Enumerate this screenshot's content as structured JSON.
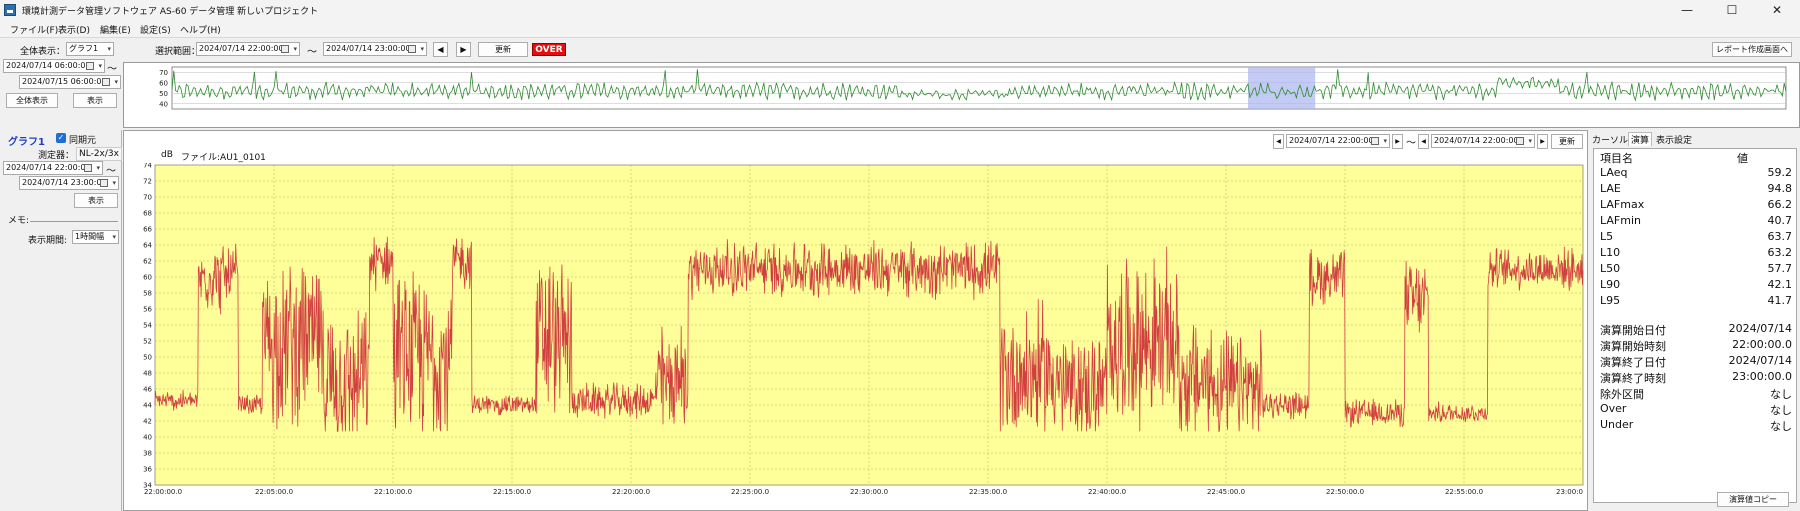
{
  "window": {
    "title": "環境計測データ管理ソフトウェア AS-60 データ管理 新しいプロジェクト",
    "minimize": "—",
    "maximize": "☐",
    "close": "✕"
  },
  "menu": [
    "ファイル(F)",
    "表示(D)",
    "編集(E)",
    "設定(S)",
    "ヘルプ(H)"
  ],
  "toolbar": {
    "all_display_label": "全体表示：",
    "graph_select": "グラフ1",
    "range_label": "選択範囲：",
    "range_start": "2024/07/14 22:00:00",
    "range_tilde": "〜",
    "range_end": "2024/07/14 23:00:00",
    "prev": "◀",
    "next": "▶",
    "update": "更新",
    "over": "OVER",
    "report": "レポート作成画面へ"
  },
  "left_top": {
    "start": "2024/07/14 06:00:00",
    "tilde": "〜",
    "end": "2024/07/15 06:00:00",
    "all_display_btn": "全体表示",
    "display_btn": "表示"
  },
  "overview": {
    "y_ticks": [
      "70",
      "60",
      "50",
      "40"
    ]
  },
  "left_panel": {
    "graph_name": "グラフ1",
    "sync_label": "同期元",
    "meter_label": "測定器：",
    "meter_value": "NL-2x/3x",
    "start": "2024/07/14 22:00:00",
    "tilde": "〜",
    "end": "2024/07/14 23:00:00",
    "display_btn": "表示",
    "memo_label": "メモ:",
    "interval_label": "表示期間:",
    "interval_value": "1時間幅"
  },
  "main": {
    "unit": "dB",
    "file_label": "ファイル:AU1_0101",
    "nav_start": "2024/07/14 22:00:00",
    "nav_tilde": "〜",
    "nav_end": "2024/07/14 22:00:00",
    "update": "更新",
    "prev": "◀",
    "next": "▶"
  },
  "right_panel": {
    "tabs": [
      "カーソル",
      "演算",
      "表示設定"
    ],
    "header_name": "項目名",
    "header_value": "値",
    "rows": [
      {
        "k": "LAeq",
        "v": "59.2"
      },
      {
        "k": "LAE",
        "v": "94.8"
      },
      {
        "k": "LAFmax",
        "v": "66.2"
      },
      {
        "k": "LAFmin",
        "v": "40.7"
      },
      {
        "k": "L5",
        "v": "63.7"
      },
      {
        "k": "L10",
        "v": "63.2"
      },
      {
        "k": "L50",
        "v": "57.7"
      },
      {
        "k": "L90",
        "v": "42.1"
      },
      {
        "k": "L95",
        "v": "41.7"
      }
    ],
    "rows2": [
      {
        "k": "演算開始日付",
        "v": "2024/07/14"
      },
      {
        "k": "演算開始時刻",
        "v": "22:00:00.0"
      },
      {
        "k": "演算終了日付",
        "v": "2024/07/14"
      },
      {
        "k": "演算終了時刻",
        "v": "23:00:00.0"
      },
      {
        "k": "除外区間",
        "v": "なし"
      },
      {
        "k": "Over",
        "v": "なし"
      },
      {
        "k": "Under",
        "v": "なし"
      }
    ],
    "copy_btn": "演算値コピー"
  },
  "chart_data": [
    {
      "type": "line",
      "name": "overview",
      "ylim": [
        35,
        75
      ],
      "y_ticks": [
        70,
        60,
        50,
        40
      ],
      "x_range": [
        "2024/07/14 06:00:00",
        "2024/07/15 06:00:00"
      ],
      "selection": [
        "2024/07/14 22:00:00",
        "2024/07/14 23:00:00"
      ],
      "color": "#2e8b2e"
    },
    {
      "type": "line",
      "name": "main",
      "ylabel": "dB",
      "ylim": [
        34,
        74
      ],
      "y_ticks": [
        74,
        72,
        70,
        68,
        66,
        64,
        62,
        60,
        58,
        56,
        54,
        52,
        50,
        48,
        46,
        44,
        42,
        40,
        38,
        36,
        34
      ],
      "x_ticks": [
        "22:00:00.0",
        "22:05:00.0",
        "22:10:00.0",
        "22:15:00.0",
        "22:20:00.0",
        "22:25:00.0",
        "22:30:00.0",
        "22:35:00.0",
        "22:40:00.0",
        "22:45:00.0",
        "22:50:00.0",
        "22:55:00.0",
        "23:00:0"
      ],
      "x_range_minutes": [
        0,
        60
      ],
      "grid": true,
      "background": "#ffff99",
      "color": "#d04040",
      "segments": [
        {
          "from": 0.0,
          "to": 1.8,
          "base": 44.5,
          "amp": 1.5
        },
        {
          "from": 1.8,
          "to": 3.5,
          "base": 60,
          "amp": 5
        },
        {
          "from": 3.5,
          "to": 4.5,
          "base": 44,
          "amp": 1.5
        },
        {
          "from": 4.5,
          "to": 7.0,
          "base": 52,
          "amp": 12
        },
        {
          "from": 7.0,
          "to": 9.0,
          "base": 47,
          "amp": 10
        },
        {
          "from": 9.0,
          "to": 10.0,
          "base": 62,
          "amp": 4
        },
        {
          "from": 10.0,
          "to": 12.5,
          "base": 50,
          "amp": 12
        },
        {
          "from": 12.5,
          "to": 13.3,
          "base": 62,
          "amp": 4
        },
        {
          "from": 13.3,
          "to": 16.0,
          "base": 44,
          "amp": 1.5
        },
        {
          "from": 16.0,
          "to": 17.5,
          "base": 52,
          "amp": 12
        },
        {
          "from": 17.5,
          "to": 21.0,
          "base": 44.5,
          "amp": 2.5
        },
        {
          "from": 21.0,
          "to": 22.4,
          "base": 47,
          "amp": 8
        },
        {
          "from": 22.4,
          "to": 35.5,
          "base": 61,
          "amp": 4
        },
        {
          "from": 35.5,
          "to": 38.0,
          "base": 48,
          "amp": 10
        },
        {
          "from": 38.0,
          "to": 40.0,
          "base": 46,
          "amp": 8
        },
        {
          "from": 40.0,
          "to": 43.0,
          "base": 52,
          "amp": 12
        },
        {
          "from": 43.0,
          "to": 44.5,
          "base": 47,
          "amp": 9
        },
        {
          "from": 44.5,
          "to": 46.5,
          "base": 46,
          "amp": 8
        },
        {
          "from": 46.5,
          "to": 48.5,
          "base": 44,
          "amp": 2
        },
        {
          "from": 48.5,
          "to": 50.0,
          "base": 60,
          "amp": 4
        },
        {
          "from": 50.0,
          "to": 52.5,
          "base": 43,
          "amp": 2
        },
        {
          "from": 52.5,
          "to": 53.5,
          "base": 57,
          "amp": 6
        },
        {
          "from": 53.5,
          "to": 56.0,
          "base": 43,
          "amp": 1.5
        },
        {
          "from": 56.0,
          "to": 60.0,
          "base": 61,
          "amp": 3
        }
      ]
    }
  ]
}
